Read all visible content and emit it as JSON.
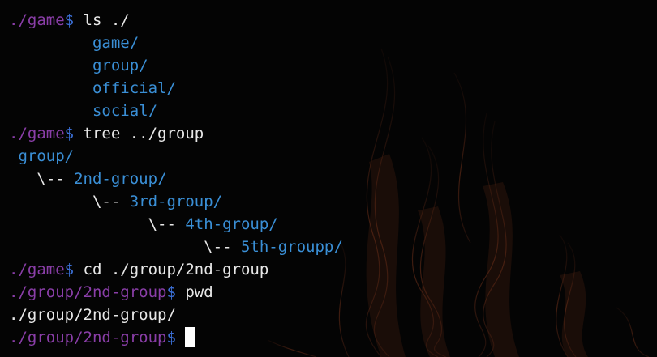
{
  "colors": {
    "background": "#040404",
    "prompt_path": "#8a3ea8",
    "prompt_dollar": "#3b6fd6",
    "command_text": "#e8e8e8",
    "directory": "#3a8fd6"
  },
  "lines": {
    "l1": {
      "path": "./game",
      "dollar": "$",
      "cmd": " ls ./"
    },
    "l2": {
      "indent": "         ",
      "dir": "game/"
    },
    "l3": {
      "indent": "         ",
      "dir": "group/"
    },
    "l4": {
      "indent": "         ",
      "dir": "official/"
    },
    "l5": {
      "indent": "         ",
      "dir": "social/"
    },
    "l6": {
      "path": "./game",
      "dollar": "$",
      "cmd": " tree ../group"
    },
    "l7": {
      "indent": " ",
      "dir": "group/"
    },
    "l8": {
      "indent": "   \\-- ",
      "dir": "2nd-group/"
    },
    "l9": {
      "indent": "         \\-- ",
      "dir": "3rd-group/"
    },
    "l10": {
      "indent": "               \\-- ",
      "dir": "4th-group/"
    },
    "l11": {
      "indent": "                     \\-- ",
      "dir": "5th-groupp/"
    },
    "l12": {
      "path": "./game",
      "dollar": "$",
      "cmd": " cd ./group/2nd-group"
    },
    "l13": {
      "path": "./group/2nd-group",
      "dollar": "$",
      "cmd": " pwd"
    },
    "l14": {
      "output": "./group/2nd-group/"
    },
    "l15": {
      "path": "./group/2nd-group",
      "dollar": "$",
      "cmd": " "
    }
  }
}
